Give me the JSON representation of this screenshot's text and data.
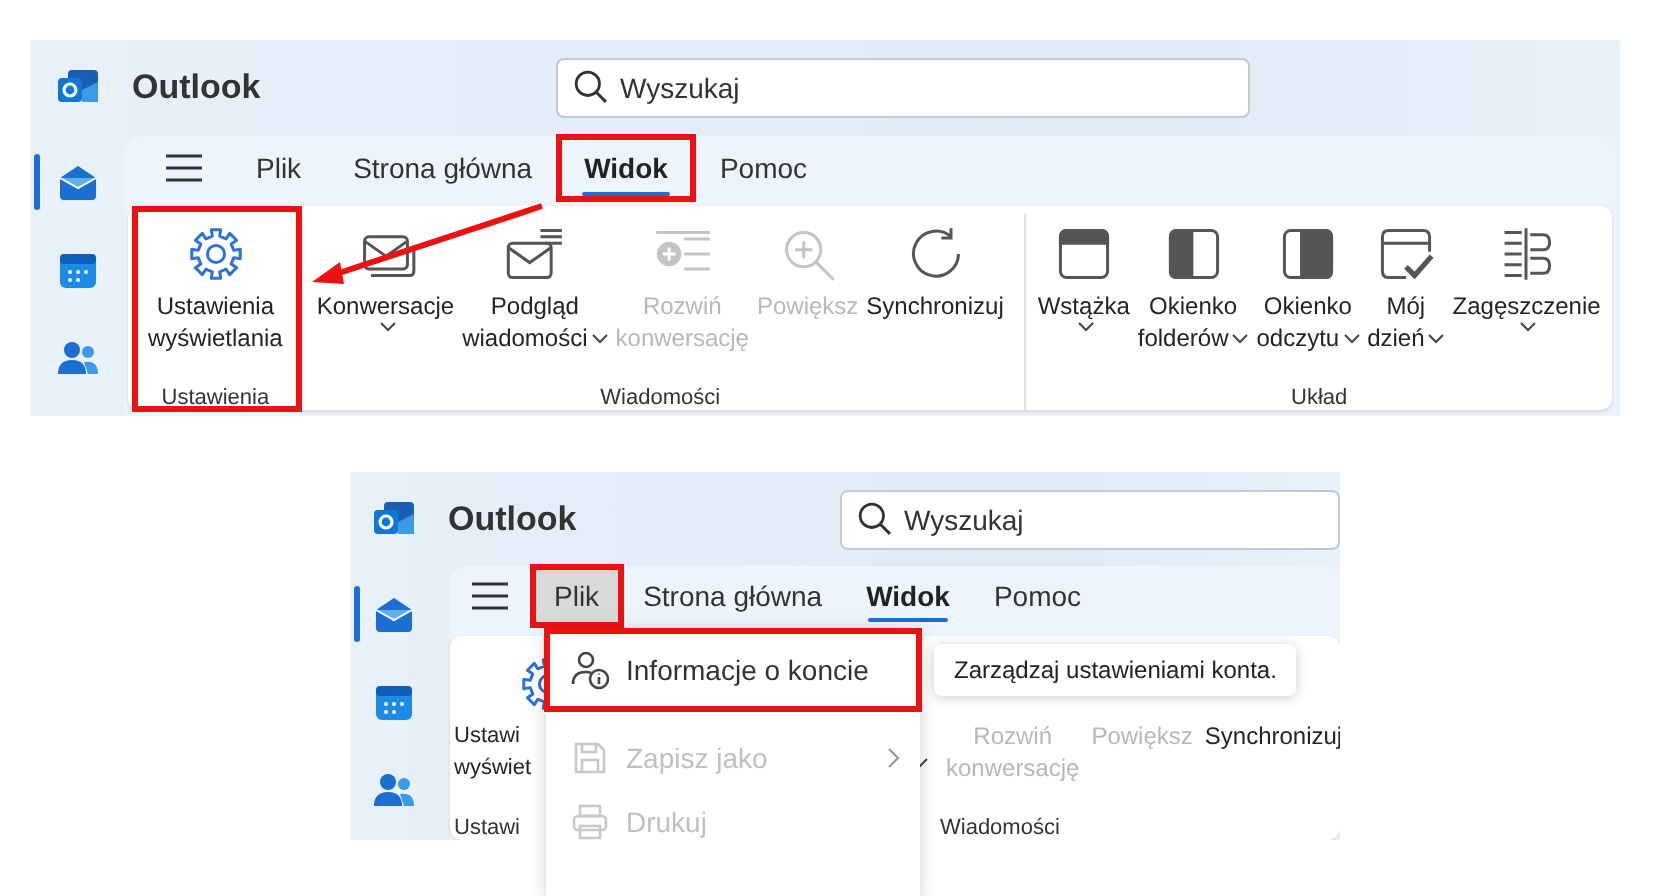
{
  "screens": [
    {
      "title": "Outlook",
      "search": {
        "placeholder": "Wyszukaj"
      },
      "nav": [
        {
          "selected": true
        },
        {
          "selected": false
        },
        {
          "selected": false
        }
      ],
      "tabs": [
        {
          "label": "Plik",
          "selected": false,
          "open": false,
          "highlighted": false
        },
        {
          "label": "Strona główna",
          "selected": false,
          "open": false,
          "highlighted": false
        },
        {
          "label": "Widok",
          "selected": true,
          "open": false,
          "highlighted": true
        },
        {
          "label": "Pomoc",
          "selected": false,
          "open": false,
          "highlighted": false
        }
      ],
      "groups": [
        {
          "label": "Ustawienia",
          "highlighted": true,
          "buttons": [
            {
              "lines": [
                "Ustawienia",
                "wyświetlania"
              ],
              "disabled": false,
              "dropdown": false
            }
          ]
        },
        {
          "label": "Wiadomości",
          "highlighted": false,
          "buttons": [
            {
              "lines": [
                "Konwersacje"
              ],
              "disabled": false,
              "dropdown": true
            },
            {
              "lines": [
                "Podgląd",
                "wiadomości"
              ],
              "disabled": false,
              "dropdown": true
            },
            {
              "lines": [
                "Rozwiń",
                "konwersację"
              ],
              "disabled": true,
              "dropdown": false
            },
            {
              "lines": [
                "Powiększ"
              ],
              "disabled": true,
              "dropdown": false
            },
            {
              "lines": [
                "Synchronizuj"
              ],
              "disabled": false,
              "dropdown": false
            }
          ]
        },
        {
          "label": "Układ",
          "highlighted": false,
          "buttons": [
            {
              "lines": [
                "Wstążka"
              ],
              "disabled": false,
              "dropdown": true
            },
            {
              "lines": [
                "Okienko",
                "folderów"
              ],
              "disabled": false,
              "dropdown": true
            },
            {
              "lines": [
                "Okienko",
                "odczytu"
              ],
              "disabled": false,
              "dropdown": true
            },
            {
              "lines": [
                "Mój",
                "dzień"
              ],
              "disabled": false,
              "dropdown": true
            },
            {
              "lines": [
                "Zagęszczenie"
              ],
              "disabled": false,
              "dropdown": true
            }
          ]
        }
      ]
    },
    {
      "title": "Outlook",
      "search": {
        "placeholder": "Wyszukaj"
      },
      "nav": [
        {
          "selected": true
        },
        {
          "selected": false
        },
        {
          "selected": false
        }
      ],
      "tabs": [
        {
          "label": "Plik",
          "selected": false,
          "open": true,
          "highlighted": true
        },
        {
          "label": "Strona główna",
          "selected": false,
          "open": false,
          "highlighted": false
        },
        {
          "label": "Widok",
          "selected": true,
          "open": false,
          "highlighted": false
        },
        {
          "label": "Pomoc",
          "selected": false,
          "open": false,
          "highlighted": false
        }
      ],
      "groups": [
        {
          "label": "Ustawi",
          "highlighted": false,
          "buttons": [
            {
              "lines": [
                "Ustawi",
                "wyświet"
              ],
              "disabled": false,
              "dropdown": false
            }
          ]
        },
        {
          "label": "Wiadomości",
          "highlighted": false,
          "buttons": [
            {
              "lines": [
                "Rozwiń",
                "konwersację"
              ],
              "disabled": true,
              "dropdown": false
            },
            {
              "lines": [
                "Powiększ"
              ],
              "disabled": true,
              "dropdown": false
            },
            {
              "lines": [
                "Synchronizuj"
              ],
              "disabled": false,
              "dropdown": false
            }
          ]
        }
      ],
      "menu": {
        "items": [
          {
            "label": "Informacje o koncie",
            "disabled": false,
            "highlighted": true,
            "submenu": false
          },
          {
            "label": "Zapisz jako",
            "disabled": true,
            "highlighted": false,
            "submenu": true
          },
          {
            "label": "Drukuj",
            "disabled": true,
            "highlighted": false,
            "submenu": false
          }
        ]
      },
      "tooltip": "Zarządzaj ustawieniami konta."
    }
  ]
}
